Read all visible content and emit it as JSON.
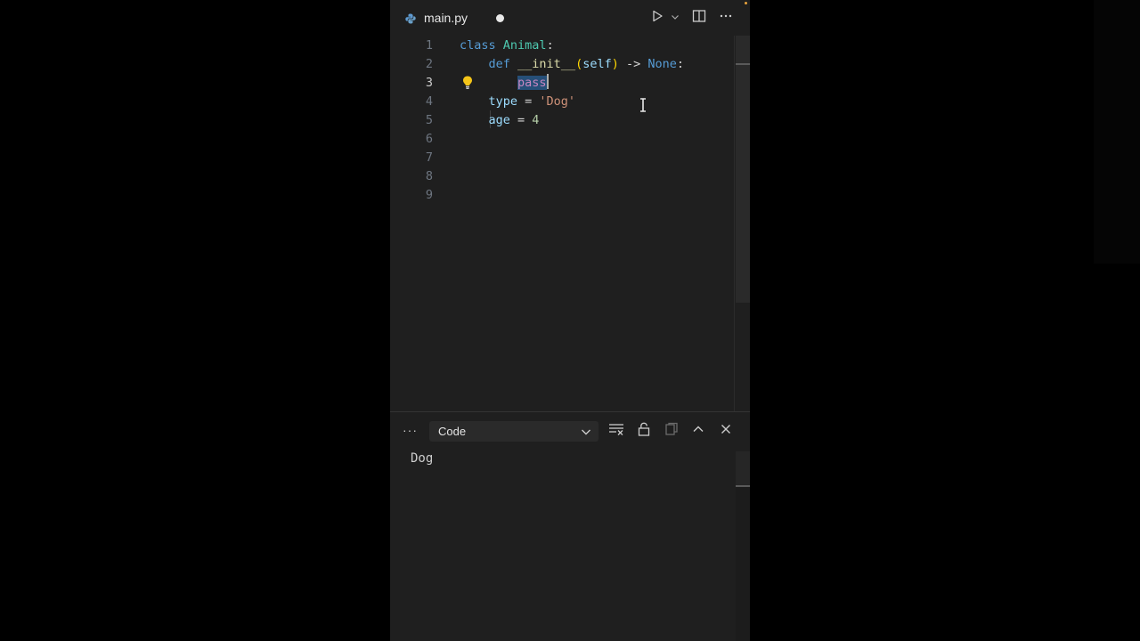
{
  "tab": {
    "filename": "main.py",
    "unsaved": true
  },
  "editor": {
    "active_line": "3",
    "lines": [
      {
        "num": "1",
        "tokens": [
          {
            "t": "class",
            "c": "kw"
          },
          {
            "t": " ",
            "c": "op"
          },
          {
            "t": "Animal",
            "c": "cls"
          },
          {
            "t": ":",
            "c": "pun"
          }
        ]
      },
      {
        "num": "2",
        "tokens": [
          {
            "t": "    ",
            "c": "op"
          },
          {
            "t": "def",
            "c": "kw"
          },
          {
            "t": " ",
            "c": "op"
          },
          {
            "t": "__init__",
            "c": "fn"
          },
          {
            "t": "(",
            "c": "paren"
          },
          {
            "t": "self",
            "c": "var"
          },
          {
            "t": ")",
            "c": "paren"
          },
          {
            "t": " -> ",
            "c": "op"
          },
          {
            "t": "None",
            "c": "kw"
          },
          {
            "t": ":",
            "c": "pun"
          }
        ]
      },
      {
        "num": "3",
        "tokens": [
          {
            "t": "        ",
            "c": "op"
          },
          {
            "t": "pass",
            "c": "selected"
          }
        ]
      },
      {
        "num": "4",
        "tokens": [
          {
            "t": "    ",
            "c": "op"
          },
          {
            "t": "type",
            "c": "var"
          },
          {
            "t": " = ",
            "c": "op"
          },
          {
            "t": "'Dog'",
            "c": "str"
          }
        ]
      },
      {
        "num": "5",
        "tokens": [
          {
            "t": "    ",
            "c": "op"
          },
          {
            "t": "age",
            "c": "var"
          },
          {
            "t": " = ",
            "c": "op"
          },
          {
            "t": "4",
            "c": "num"
          }
        ]
      },
      {
        "num": "6",
        "tokens": []
      },
      {
        "num": "7",
        "tokens": []
      },
      {
        "num": "8",
        "tokens": []
      },
      {
        "num": "9",
        "tokens": []
      }
    ]
  },
  "panel": {
    "more_label": "···",
    "selected_output": "Code",
    "output_text": "Dog"
  },
  "colors": {
    "editor_bg": "#1f1f1f",
    "selection": "#264f78",
    "keyword": "#569cd6",
    "class": "#4ec9b0",
    "function": "#dcdcaa",
    "string": "#ce9178",
    "number": "#b5cea8",
    "bulb": "#f5c518"
  },
  "icons": [
    "python-file-icon",
    "run-icon",
    "chevron-down-icon",
    "split-editor-icon",
    "more-icon",
    "lightbulb-icon",
    "filter-icon",
    "lock-icon",
    "copy-icon",
    "chevron-up-icon",
    "close-icon"
  ]
}
